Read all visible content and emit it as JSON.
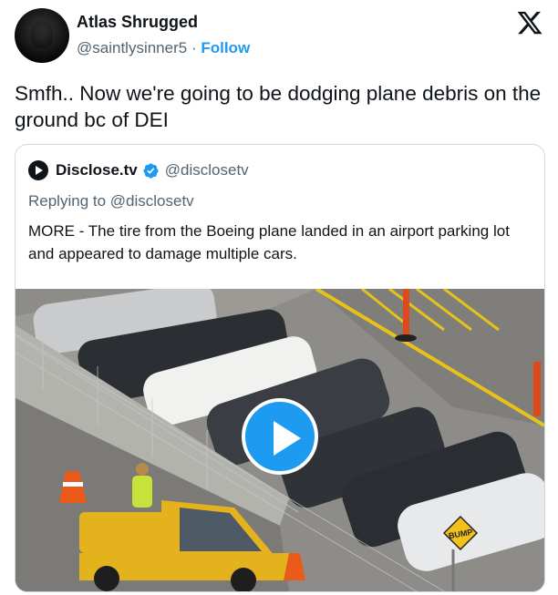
{
  "author": {
    "name": "Atlas Shrugged",
    "handle": "@saintlysinner5",
    "separator": "·",
    "follow_label": "Follow"
  },
  "platform_icon": "x-logo-icon",
  "tweet": {
    "text": "Smfh.. Now we're going to be dodging plane debris on the ground bc of DEI"
  },
  "quoted": {
    "name": "Disclose.tv",
    "handle": "@disclosetv",
    "verified_icon": "verified-badge-icon",
    "replying_to": "Replying to @disclosetv",
    "text": "MORE - The tire from the Boeing plane landed in an airport parking lot and appeared to damage multiple cars.",
    "media": {
      "type": "video",
      "sign_text": "BUMP",
      "play_icon": "play-icon"
    }
  },
  "colors": {
    "accent": "#1d9bf0",
    "text": "#0f1419",
    "muted": "#536471",
    "border": "#cfd9de"
  }
}
